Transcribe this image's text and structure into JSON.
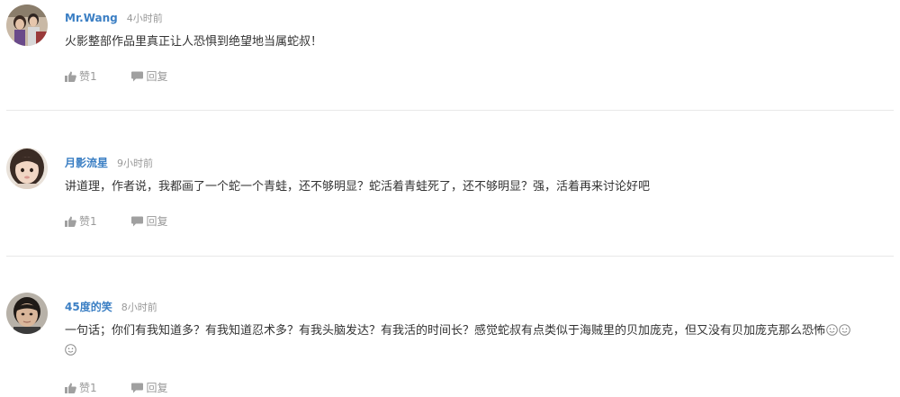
{
  "comments": [
    {
      "user": "Mr.Wang",
      "time": "4小时前",
      "text": "火影整部作品里真正让人恐惧到绝望地当属蛇叔！",
      "text_cont": "",
      "like_label": "赞1",
      "reply_label": "回复"
    },
    {
      "user": "月影流星",
      "time": "9小时前",
      "text": "讲道理，作者说，我都画了一个蛇一个青蛙，还不够明显？蛇活着青蛙死了，还不够明显？强，活着再来讨论好吧",
      "text_cont": "",
      "like_label": "赞1",
      "reply_label": "回复"
    },
    {
      "user": "45度的笑",
      "time": "8小时前",
      "text": "一句话；你们有我知道多？有我知道忍术多？有我头脑发达？有我活的时间长？感觉蛇叔有点类似于海贼里的贝加庞克，但又没有贝加庞克那么恐怖",
      "text_cont": "",
      "like_label": "赞1",
      "reply_label": "回复"
    }
  ],
  "colors": {
    "username": "#3b7fc4",
    "muted": "#999999",
    "text": "#333333",
    "divider": "#e8e8e8"
  },
  "icons": {
    "like": "thumbs-up-icon",
    "reply": "speech-bubble-icon",
    "emoji": "smiley-emoji-icon"
  }
}
